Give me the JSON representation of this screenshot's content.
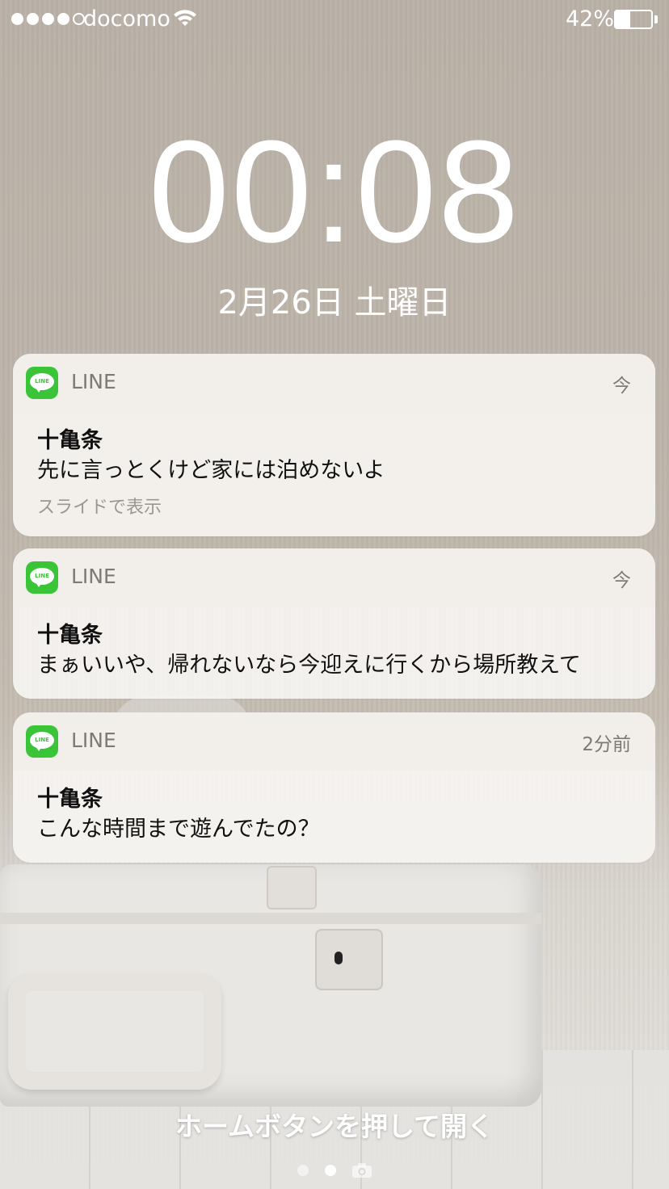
{
  "status_bar": {
    "signal_bars_filled": 4,
    "signal_bars_total": 5,
    "carrier": "docomo",
    "wifi_icon": "wifi-icon",
    "battery_percent": "42%",
    "battery_level": 0.42
  },
  "lock_screen": {
    "time": "00:08",
    "date": "2月26日 土曜日"
  },
  "notifications": [
    {
      "app": "LINE",
      "app_icon": "line-app-icon",
      "time": "今",
      "sender": "十亀条",
      "message": "先に言っとくけど家には泊めないよ",
      "hint": "スライドで表示"
    },
    {
      "app": "LINE",
      "app_icon": "line-app-icon",
      "time": "今",
      "sender": "十亀条",
      "message": "まぁいいや、帰れないなら今迎えに行くから場所教えて"
    },
    {
      "app": "LINE",
      "app_icon": "line-app-icon",
      "time": "2分前",
      "sender": "十亀条",
      "message": "こんな時間まで遊んでたの？"
    }
  ],
  "bottom": {
    "unlock_hint": "ホームボタンを押して開く",
    "page_dots": 2,
    "active_page": 2,
    "camera_icon": "camera-icon"
  },
  "icon_text": {
    "line_logo": "LINE"
  },
  "colors": {
    "line_green": "#3ac538",
    "text_white": "#ffffff"
  }
}
